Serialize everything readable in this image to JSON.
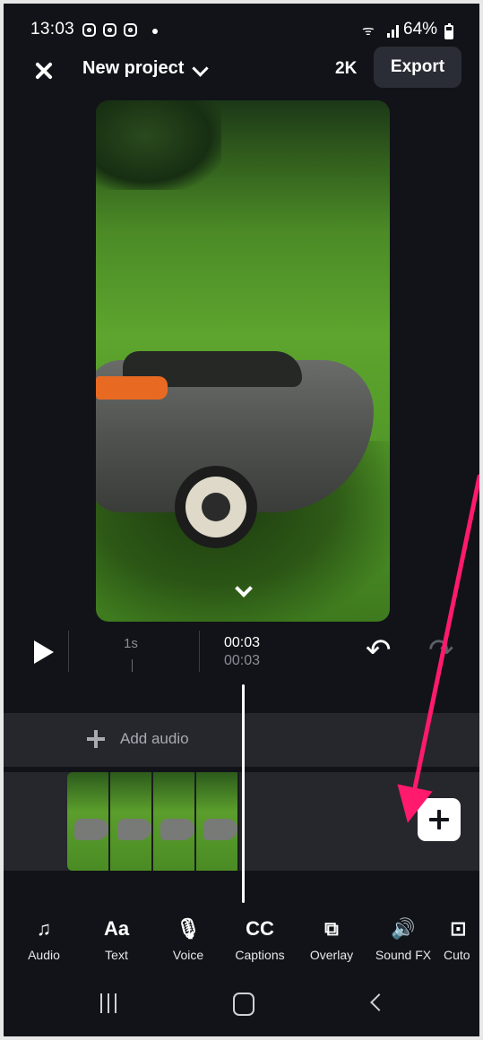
{
  "status_bar": {
    "time": "13:03",
    "battery": "64%",
    "icons": [
      "instagram-icon",
      "instagram-icon",
      "instagram-icon",
      "notification-dot",
      "wifi-icon",
      "signal-icon",
      "battery-icon"
    ]
  },
  "header": {
    "project_title": "New project",
    "resolution": "2K",
    "export_label": "Export"
  },
  "playback": {
    "ruler_mark": "1s",
    "current_time": "00:03",
    "total_time": "00:03"
  },
  "timeline": {
    "add_audio_label": "Add audio",
    "clip_frames": 4
  },
  "toolbar": {
    "items": [
      {
        "label": "Audio",
        "glyph": "♫"
      },
      {
        "label": "Text",
        "glyph": "Aa"
      },
      {
        "label": "Voice",
        "glyph": "🎙"
      },
      {
        "label": "Captions",
        "glyph": "CC"
      },
      {
        "label": "Overlay",
        "glyph": "⧉"
      },
      {
        "label": "Sound FX",
        "glyph": "🔊"
      },
      {
        "label": "Cuto",
        "glyph": "⊡"
      }
    ]
  },
  "colors": {
    "background": "#111318",
    "track": "#25272c",
    "annotation_arrow": "#ff1a6e",
    "nav_accent": "#5a2ac8"
  }
}
